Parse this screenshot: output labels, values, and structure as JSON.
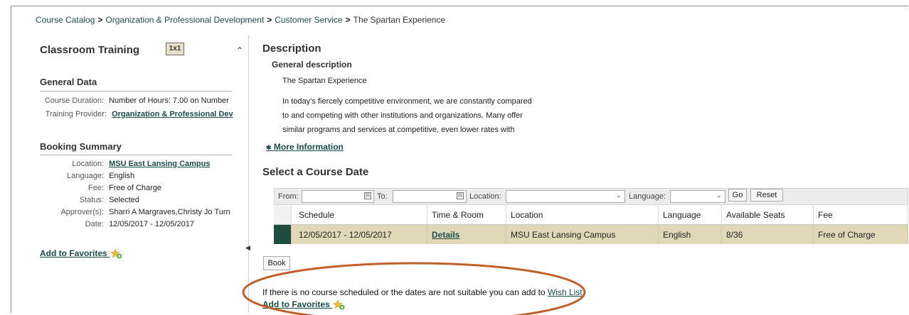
{
  "breadcrumb": {
    "items": [
      "Course Catalog",
      "Organization & Professional Development",
      "Customer Service",
      "The Spartan Experience"
    ],
    "separator": ">"
  },
  "left_panel": {
    "title": "Classroom Training",
    "badge": "1x1",
    "general_data": {
      "heading": "General Data",
      "course_duration_label": "Course Duration:",
      "course_duration_value": "Number of Hours: 7.00 on Number",
      "training_provider_label": "Training Provider:",
      "training_provider_value": "Organization & Professional Dev"
    },
    "booking_summary": {
      "heading": "Booking Summary",
      "location_label": "Location:",
      "location_value": "MSU East Lansing Campus",
      "language_label": "Language:",
      "language_value": "English",
      "fee_label": "Fee:",
      "fee_value": "Free of Charge",
      "status_label": "Status:",
      "status_value": "Selected",
      "approvers_label": "Approver(s):",
      "approvers_value": "Sharri A Margraves,Christy Jo Turn",
      "date_label": "Date:",
      "date_value": "12/05/2017 - 12/05/2017"
    },
    "add_to_favorites": "Add to Favorites"
  },
  "description": {
    "heading": "Description",
    "subheading": "General description",
    "course_name": "The Spartan Experience",
    "lines": [
      "In today’s fiercely competitive environment, we are constantly compared",
      "to and competing with other institutions and organizations. Many offer",
      "similar programs and services at competitive, even lower rates with"
    ],
    "more_info": "More Information"
  },
  "course_date": {
    "heading": "Select a Course Date",
    "filters": {
      "from_label": "From:",
      "from_value": "",
      "to_label": "To:",
      "to_value": "",
      "location_label": "Location:",
      "location_value": "",
      "language_label": "Language:",
      "language_value": "",
      "go_label": "Go",
      "reset_label": "Reset"
    },
    "columns": [
      "Schedule",
      "Time & Room",
      "Location",
      "Language",
      "Available Seats",
      "Fee"
    ],
    "rows": [
      {
        "schedule": "12/05/2017 - 12/05/2017",
        "time_room": "Details",
        "location": "MSU East Lansing Campus",
        "language": "English",
        "seats": "8/36",
        "fee": "Free of Charge"
      }
    ],
    "book_label": "Book",
    "wishlist_text": "If there is no course scheduled or the dates are not suitable you can add to",
    "wishlist_link": "Wish List",
    "add_to_favorites": "Add to Favorites"
  },
  "colors": {
    "link": "#1a4d4a",
    "row_highlight": "#e1d8b8",
    "row_selector": "#1f4d3f",
    "annotation_ellipse": "#c0602a"
  }
}
